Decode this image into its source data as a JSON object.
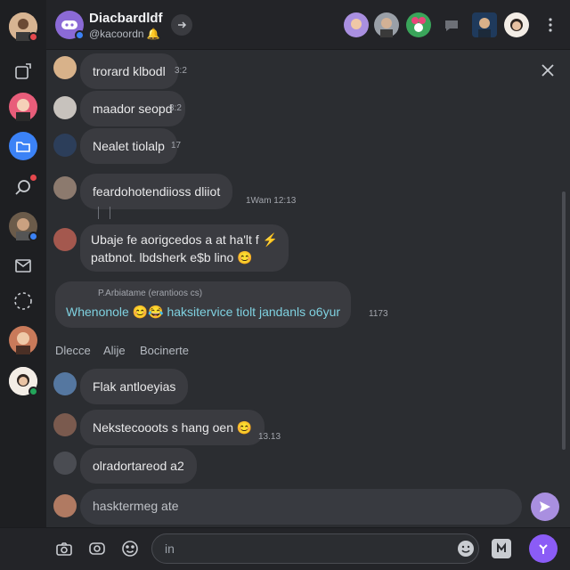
{
  "header": {
    "title": "Diacbardldf",
    "subtitle": "@kacoordn",
    "subtitle_emoji": "🔔"
  },
  "messages": [
    {
      "text": "trorard klbodl",
      "time": "3:2"
    },
    {
      "text": "maador seopd",
      "time": "3:2"
    },
    {
      "text": "Nealet tiolalp",
      "time": "17"
    },
    {
      "text": "feardohotendiioss dliiot",
      "time": "1Wam  12:13"
    },
    {
      "text": "Ubaje fe aorigcedos a at ha'lt f ⚡\npatbnot. lbdsherk e$b lino 😊",
      "time": ""
    },
    {
      "quote": "P.Arbiatame (erantioos cs)",
      "text": "Whenonole 😊😂 haksitervice tiolt jandanls o6yur",
      "time": "1173"
    },
    {
      "text": "Flak antloeyias",
      "time": ""
    },
    {
      "text": "Nekstecooots s hang oen 😊",
      "time": "13.13"
    },
    {
      "text": "olradortareod a2",
      "time": ""
    }
  ],
  "section_labels": [
    "Dlecce",
    "Alije",
    "Bocinerte"
  ],
  "composer": {
    "draft": "hasktermeg ate",
    "placeholder": "in"
  },
  "colors": {
    "accent": "#a98fe0",
    "bg": "#2b2d31"
  }
}
